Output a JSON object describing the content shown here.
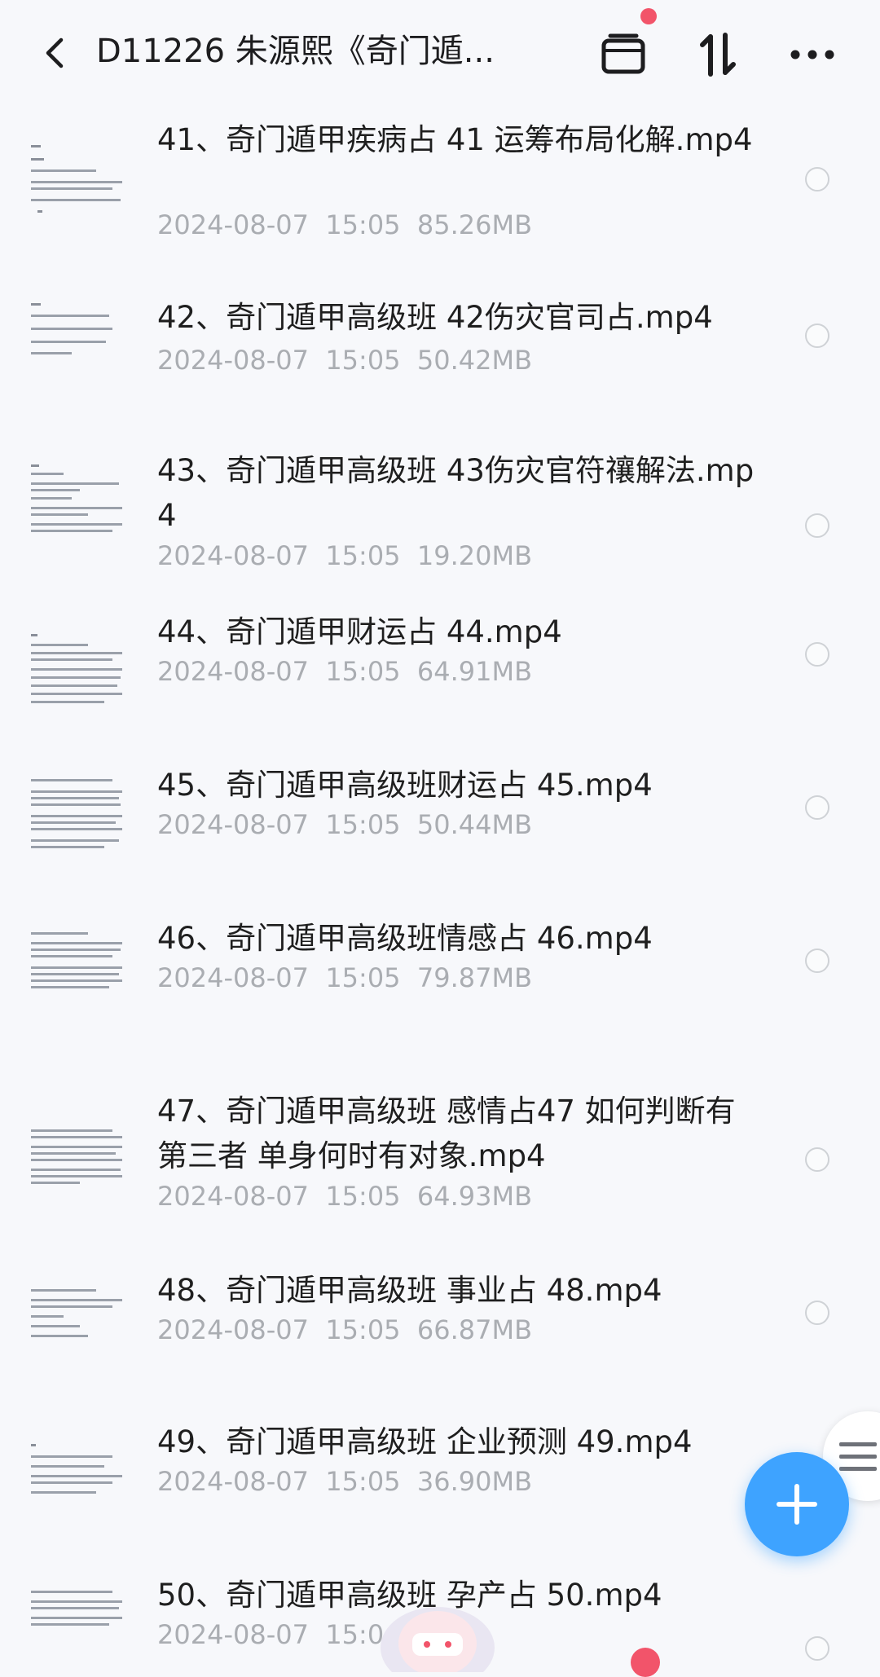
{
  "header": {
    "back_icon": "chevron-left-icon",
    "title": "D11226 朱源熙《奇门遁...",
    "icons": [
      "archive-icon",
      "sort-icon",
      "more-icon"
    ],
    "accent_dot_color": "#f2546a"
  },
  "files": [
    {
      "name": "41、奇门遁甲疾病占 41 运筹布局化解.mp4",
      "date": "2024-08-07",
      "time": "15:05",
      "size": "85.26MB"
    },
    {
      "name": "42、奇门遁甲高级班  42伤灾官司占.mp4",
      "date": "2024-08-07",
      "time": "15:05",
      "size": "50.42MB"
    },
    {
      "name": "43、奇门遁甲高级班  43伤灾官符禳解法.mp4",
      "date": "2024-08-07",
      "time": "15:05",
      "size": "19.20MB"
    },
    {
      "name": "44、奇门遁甲财运占 44.mp4",
      "date": "2024-08-07",
      "time": "15:05",
      "size": "64.91MB"
    },
    {
      "name": "45、奇门遁甲高级班财运占 45.mp4",
      "date": "2024-08-07",
      "time": "15:05",
      "size": "50.44MB"
    },
    {
      "name": "46、奇门遁甲高级班情感占 46.mp4",
      "date": "2024-08-07",
      "time": "15:05",
      "size": "79.87MB"
    },
    {
      "name": "47、奇门遁甲高级班 感情占47 如何判断有第三者 单身何时有对象.mp4",
      "date": "2024-08-07",
      "time": "15:05",
      "size": "64.93MB"
    },
    {
      "name": "48、奇门遁甲高级班 事业占 48.mp4",
      "date": "2024-08-07",
      "time": "15:05",
      "size": "66.87MB"
    },
    {
      "name": "49、奇门遁甲高级班 企业预测 49.mp4",
      "date": "2024-08-07",
      "time": "15:05",
      "size": "36.90MB"
    },
    {
      "name": "50、奇门遁甲高级班 孕产占 50.mp4",
      "date": "2024-08-07",
      "time": "15:0",
      "size": ""
    }
  ],
  "fab": {
    "icon": "plus-icon",
    "color": "#3ea3ff"
  },
  "side_handle": {
    "icon": "menu-icon"
  }
}
